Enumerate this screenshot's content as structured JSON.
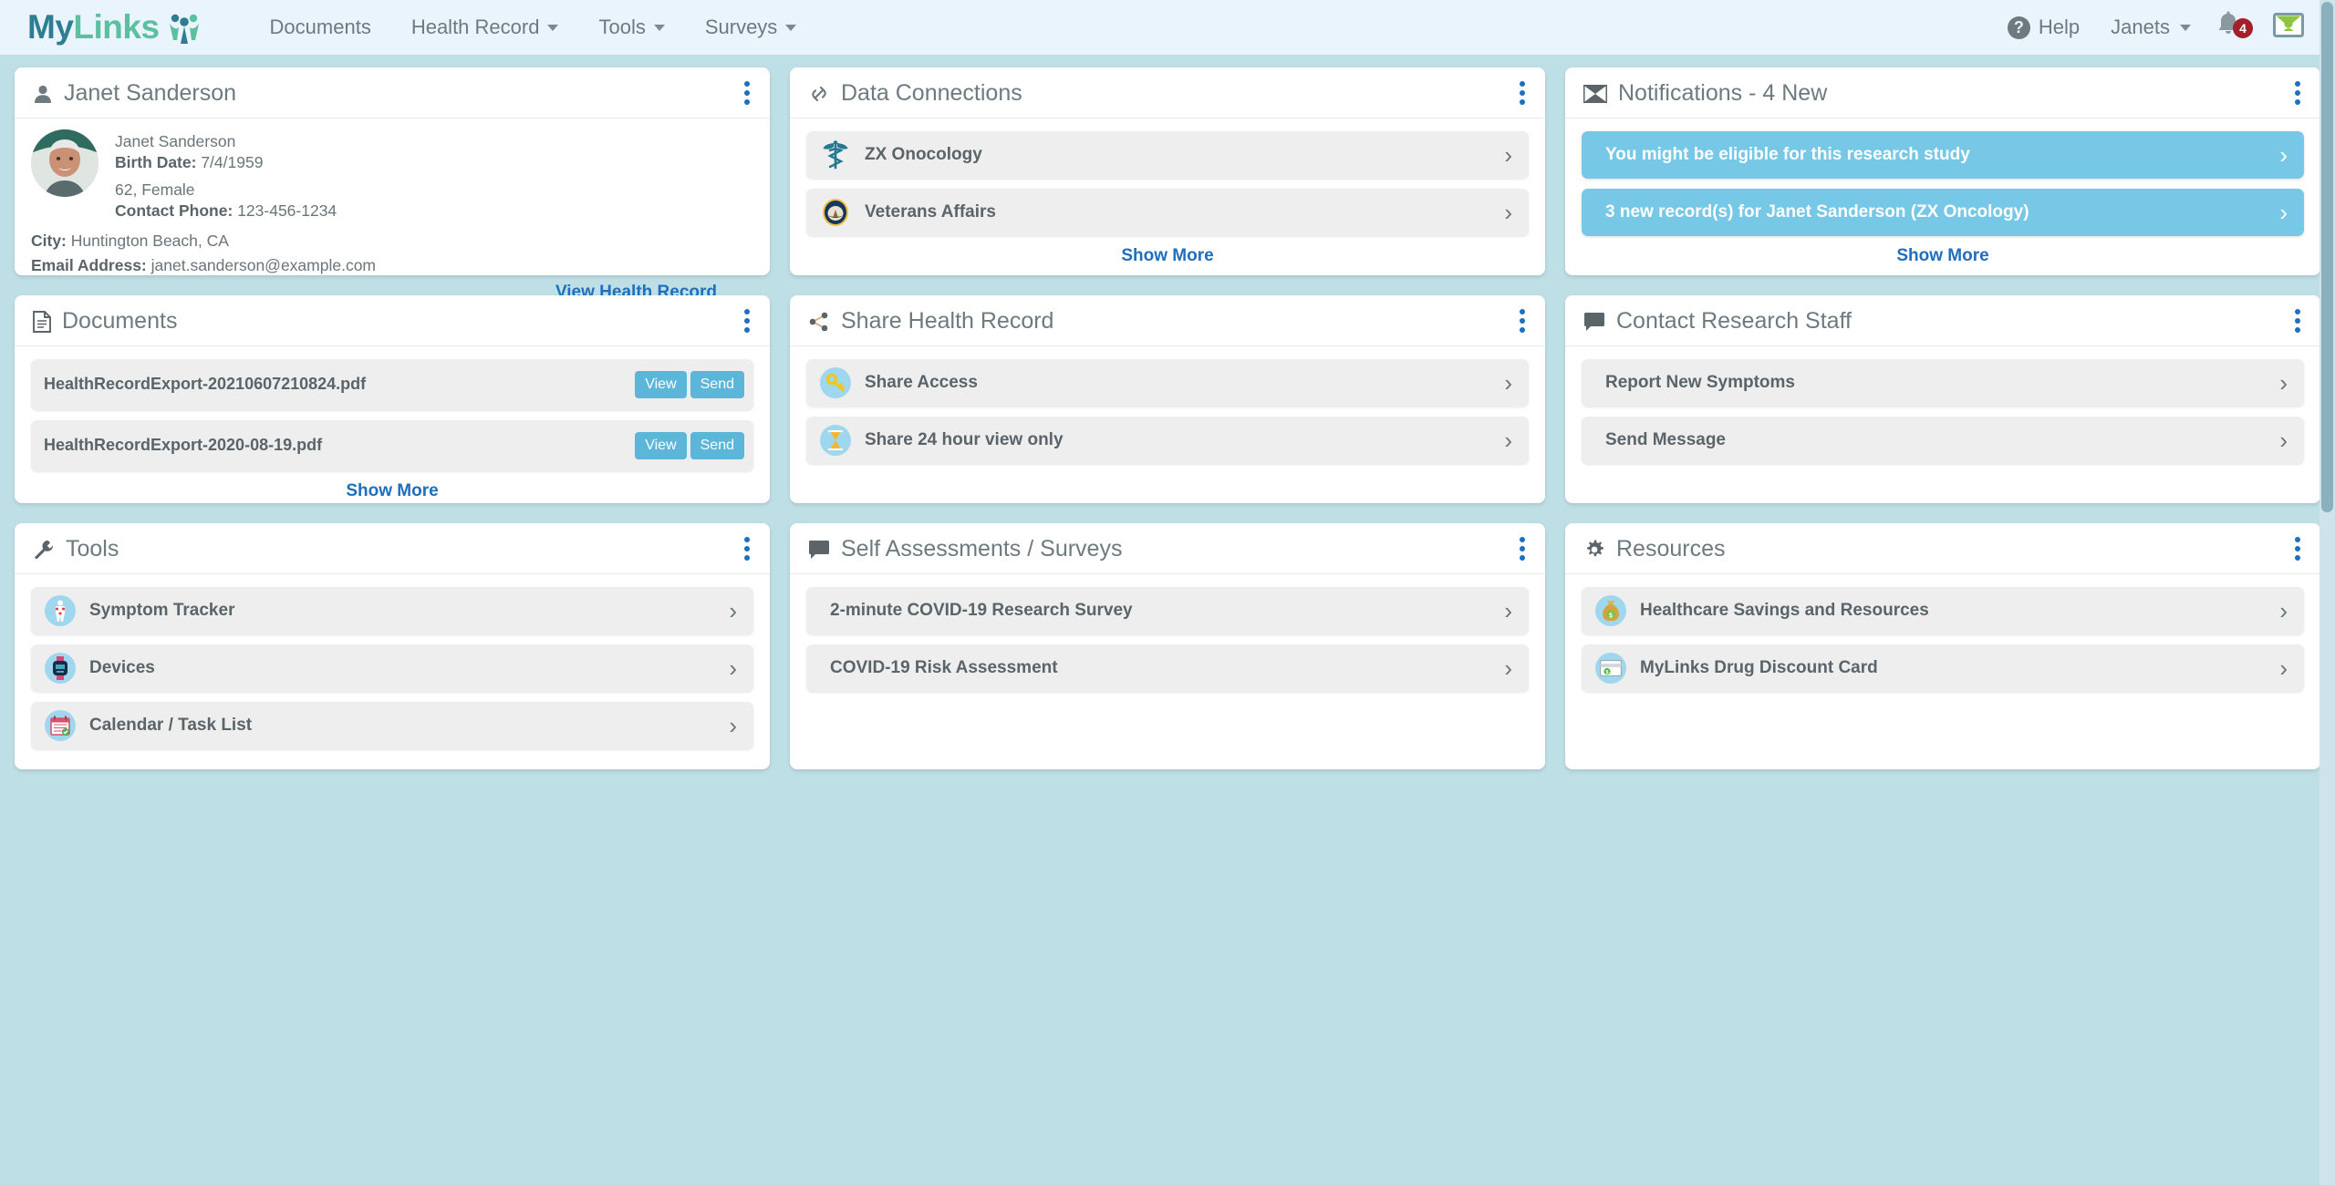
{
  "navbar": {
    "brand_first": "My",
    "brand_second": "Links",
    "brand_icon": "people-logo-icon",
    "links": [
      {
        "label": "Documents",
        "has_caret": false
      },
      {
        "label": "Health Record",
        "has_caret": true
      },
      {
        "label": "Tools",
        "has_caret": true
      },
      {
        "label": "Surveys",
        "has_caret": true
      }
    ],
    "help_label": "Help",
    "help_icon": "question-circle-icon",
    "user_label": "Janets",
    "bell_icon": "bell-icon",
    "bell_badge": "4",
    "mail_icon": "envelope-icon"
  },
  "cards": {
    "profile": {
      "title": "Janet Sanderson",
      "icon": "user-icon",
      "kebab_icon": "kebab-menu-icon",
      "avatar_icon": "avatar-photo",
      "name": "Janet Sanderson",
      "birth_date_label": "Birth Date:",
      "birth_date_value": "7/4/1959",
      "age_sex": "62, Female",
      "phone_label": "Contact Phone:",
      "phone_value": "123-456-1234",
      "city_label": "City:",
      "city_value": "Huntington Beach, CA",
      "email_label": "Email Address:",
      "email_value": "janet.sanderson@example.com",
      "view_link": "View Health Record"
    },
    "data_connections": {
      "title": "Data Connections",
      "icon": "link-chain-icon",
      "kebab_icon": "kebab-menu-icon",
      "items": [
        {
          "label": "ZX Onocology",
          "icon": "caduceus-icon"
        },
        {
          "label": "Veterans Affairs",
          "icon": "va-seal-icon"
        }
      ],
      "show_more": "Show More"
    },
    "notifications": {
      "title": "Notifications - 4 New",
      "icon": "envelope-open-icon",
      "kebab_icon": "kebab-menu-icon",
      "items": [
        {
          "label": "You might be eligible for this research study"
        },
        {
          "label": "3 new record(s) for Janet Sanderson (ZX Oncology)"
        }
      ],
      "show_more": "Show More"
    },
    "documents": {
      "title": "Documents",
      "icon": "document-icon",
      "kebab_icon": "kebab-menu-icon",
      "view_label": "View",
      "send_label": "Send",
      "items": [
        {
          "name": "HealthRecordExport-20210607210824.pdf"
        },
        {
          "name": "HealthRecordExport-2020-08-19.pdf"
        }
      ],
      "show_more": "Show More"
    },
    "share": {
      "title": "Share Health Record",
      "icon": "share-nodes-icon",
      "kebab_icon": "kebab-menu-icon",
      "items": [
        {
          "label": "Share Access",
          "icon": "key-icon"
        },
        {
          "label": "Share 24 hour view only",
          "icon": "hourglass-icon"
        }
      ]
    },
    "contact": {
      "title": "Contact Research Staff",
      "icon": "chat-bubble-icon",
      "kebab_icon": "kebab-menu-icon",
      "items": [
        {
          "label": "Report New Symptoms"
        },
        {
          "label": "Send Message"
        }
      ]
    },
    "tools": {
      "title": "Tools",
      "icon": "wrench-icon",
      "kebab_icon": "kebab-menu-icon",
      "items": [
        {
          "label": "Symptom Tracker",
          "icon": "body-symptom-icon"
        },
        {
          "label": "Devices",
          "icon": "smartwatch-icon"
        },
        {
          "label": "Calendar / Task List",
          "icon": "calendar-icon"
        }
      ]
    },
    "surveys": {
      "title": "Self Assessments / Surveys",
      "icon": "chat-bubble-icon",
      "kebab_icon": "kebab-menu-icon",
      "items": [
        {
          "label": "2-minute COVID-19 Research Survey"
        },
        {
          "label": "COVID-19 Risk Assessment"
        }
      ]
    },
    "resources": {
      "title": "Resources",
      "icon": "gear-icon",
      "kebab_icon": "kebab-menu-icon",
      "items": [
        {
          "label": "Healthcare Savings and Resources",
          "icon": "money-bag-icon"
        },
        {
          "label": "MyLinks Drug Discount Card",
          "icon": "discount-card-icon"
        }
      ]
    }
  },
  "colors": {
    "page_background": "#bfdfe6",
    "navbar_background": "#e9f4fc",
    "brand_teal": "#2e7d92",
    "brand_green": "#5bbfa0",
    "link_blue": "#1e6fbd",
    "notification_blue": "#77c7e6",
    "button_blue": "#5bb6d9",
    "badge_red": "#a3202a",
    "row_gray": "#eeeeee",
    "text_gray": "#6d7a80"
  }
}
